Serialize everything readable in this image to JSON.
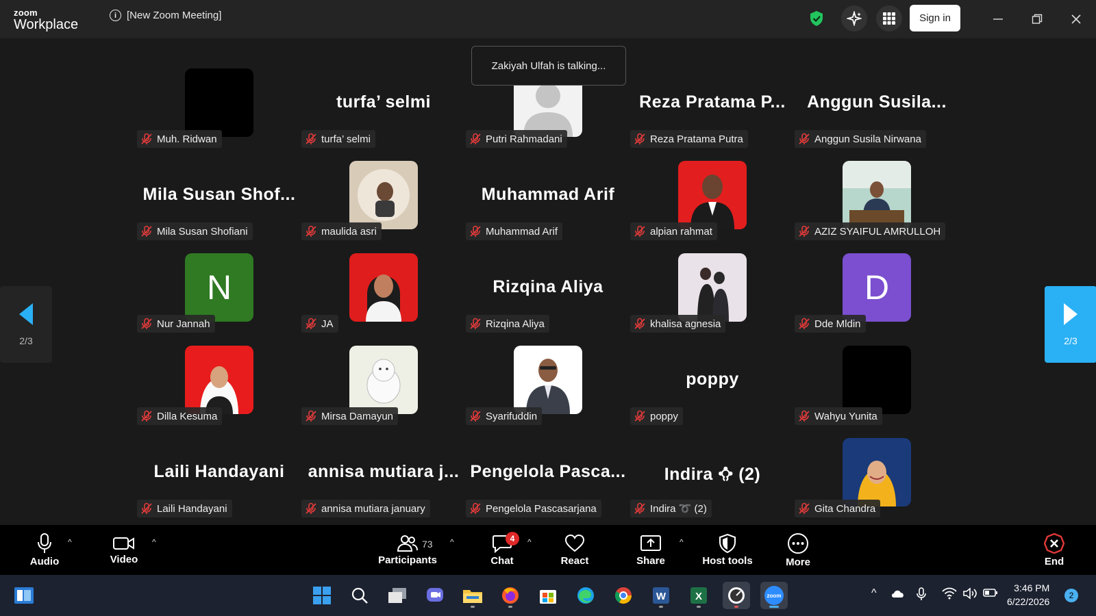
{
  "app": {
    "brand_top": "zoom",
    "brand_bottom": "Workplace",
    "meeting_title": "[New Zoom Meeting]",
    "signin_label": "Sign in",
    "accent": "#2ab0f5"
  },
  "talking_banner": "Zakiyah Ulfah is talking...",
  "pager": {
    "left_label": "2/3",
    "right_label": "2/3"
  },
  "participants": [
    {
      "big": "",
      "label": "Muh. Ridwan",
      "photo": "black"
    },
    {
      "big": "turfa’ selmi",
      "label": "turfa’ selmi"
    },
    {
      "big": "",
      "label": "Putri Rahmadani",
      "photo": "default-avatar"
    },
    {
      "big": "Reza Pratama P...",
      "label": "Reza Pratama Putra"
    },
    {
      "big": "Anggun Susila...",
      "label": "Anggun Susila Nirwana"
    },
    {
      "big": "Mila Susan Shof...",
      "label": "Mila Susan Shofiani"
    },
    {
      "big": "",
      "label": "maulida asri",
      "photo": "photo-beige"
    },
    {
      "big": "Muhammad Arif",
      "label": "Muhammad Arif"
    },
    {
      "big": "",
      "label": "alpian rahmat",
      "photo": "photo-red-suit"
    },
    {
      "big": "",
      "label": "AZIZ SYAIFUL AMRULLOH",
      "photo": "photo-office"
    },
    {
      "big": "",
      "label": "Nur Jannah",
      "photo": "letter",
      "letter": "N",
      "color": "#2f7a23"
    },
    {
      "big": "",
      "label": "JA",
      "photo": "photo-red-hijab"
    },
    {
      "big": "Rizqina Aliya",
      "label": "Rizqina Aliya"
    },
    {
      "big": "",
      "label": "khalisa agnesia",
      "photo": "photo-couple"
    },
    {
      "big": "",
      "label": "Dde Mldin",
      "photo": "letter",
      "letter": "D",
      "color": "#7b4fd0"
    },
    {
      "big": "",
      "label": "Dilla Kesuma",
      "photo": "photo-red-hijab-white"
    },
    {
      "big": "",
      "label": "Mirsa Damayun",
      "photo": "photo-bear"
    },
    {
      "big": "",
      "label": "Syarifuddin",
      "photo": "photo-white-suit"
    },
    {
      "big": "poppy",
      "label": "poppy"
    },
    {
      "big": "",
      "label": "Wahyu Yunita",
      "photo": "black"
    },
    {
      "big": "Laili Handayani",
      "label": "Laili Handayani"
    },
    {
      "big": "annisa mutiara j...",
      "label": "annisa mutiara january"
    },
    {
      "big": "Pengelola Pasca...",
      "label": "Pengelola Pascasarjana"
    },
    {
      "big": "Indira 𖢿 (2)",
      "label": "Indira ➰ (2)"
    },
    {
      "big": "",
      "label": "Gita Chandra",
      "photo": "photo-yellow"
    }
  ],
  "toolbar": {
    "audio": "Audio",
    "video": "Video",
    "participants": "Participants",
    "participants_count": "73",
    "chat": "Chat",
    "chat_badge": "4",
    "react": "React",
    "share": "Share",
    "host_tools": "Host tools",
    "more": "More",
    "end": "End"
  },
  "taskbar": {
    "time": "3:46 PM",
    "date": "6/22/2026",
    "notifications": "2"
  }
}
